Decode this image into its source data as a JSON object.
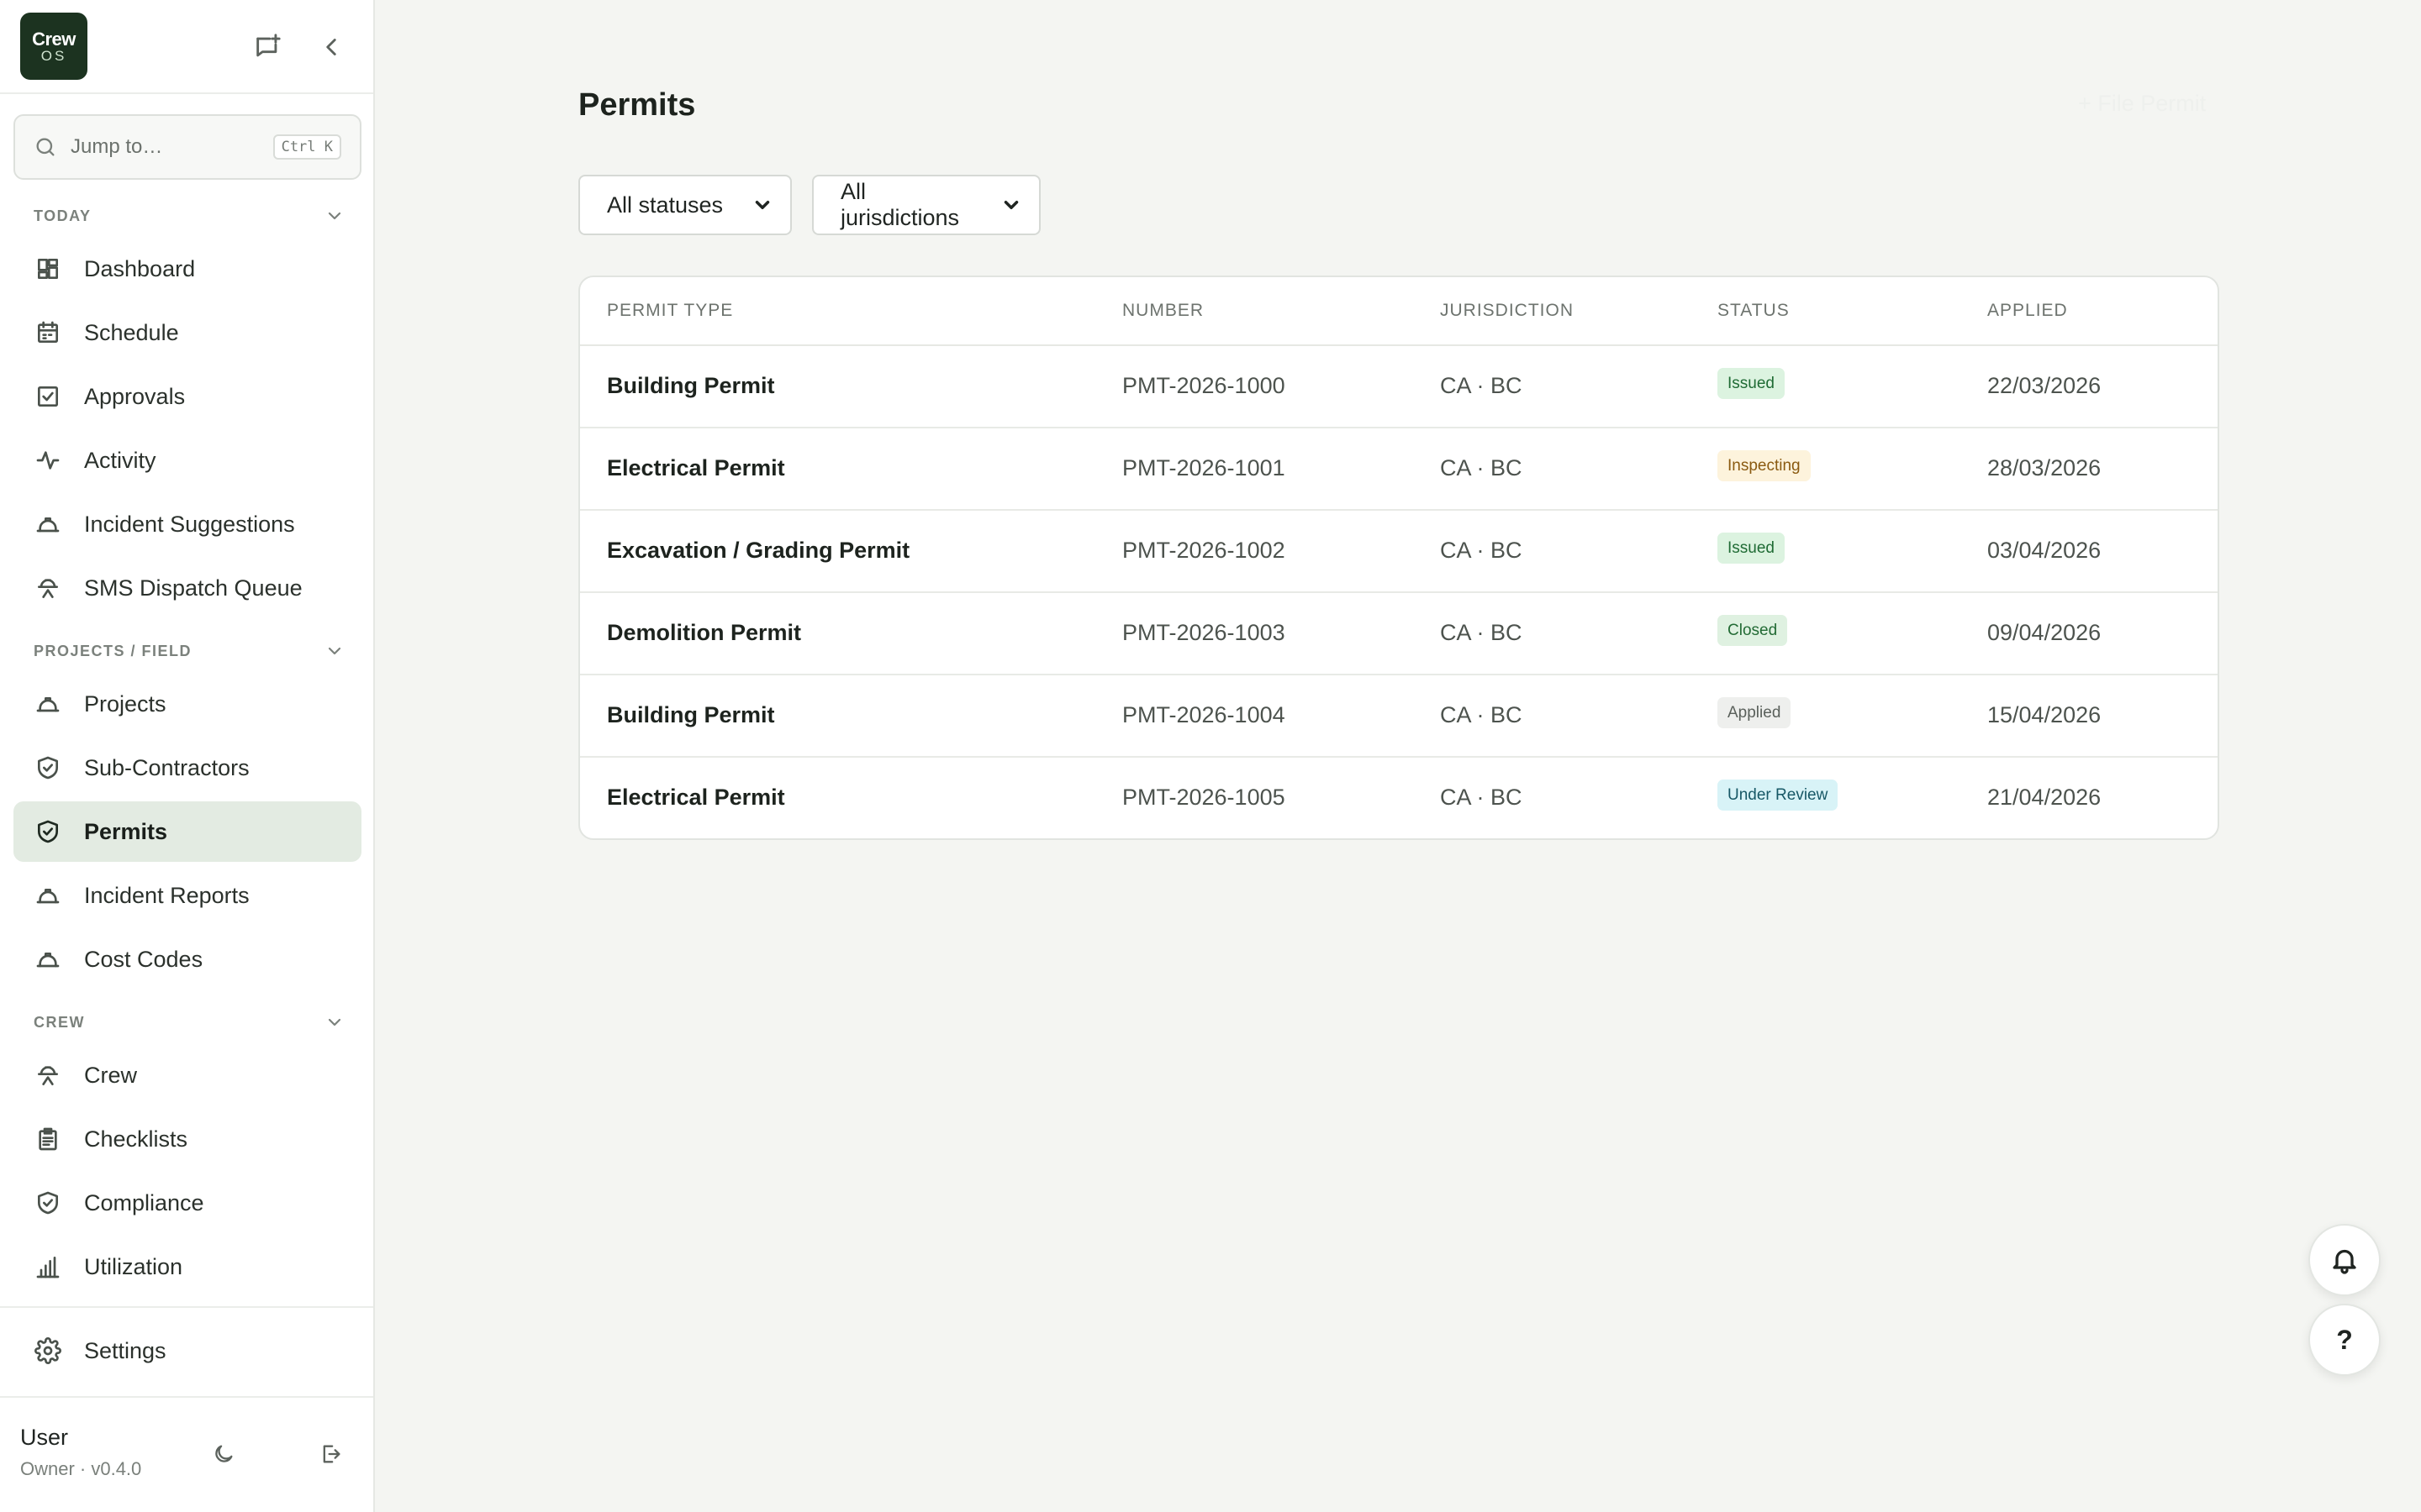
{
  "brand": {
    "line1": "Crew",
    "line2": "OS"
  },
  "search": {
    "placeholder": "Jump to…",
    "shortcut": "Ctrl K"
  },
  "sidebar": {
    "sections": [
      {
        "title": "TODAY",
        "items": [
          {
            "label": "Dashboard",
            "icon": "dashboard-icon"
          },
          {
            "label": "Schedule",
            "icon": "calendar-icon"
          },
          {
            "label": "Approvals",
            "icon": "checkbox-icon"
          },
          {
            "label": "Activity",
            "icon": "activity-icon"
          },
          {
            "label": "Incident Suggestions",
            "icon": "hardhat-icon"
          },
          {
            "label": "SMS Dispatch Queue",
            "icon": "worker-icon"
          }
        ]
      },
      {
        "title": "PROJECTS / FIELD",
        "items": [
          {
            "label": "Projects",
            "icon": "hardhat-icon"
          },
          {
            "label": "Sub-Contractors",
            "icon": "shield-check-icon"
          },
          {
            "label": "Permits",
            "icon": "shield-check-icon",
            "active": true
          },
          {
            "label": "Incident Reports",
            "icon": "hardhat-icon"
          },
          {
            "label": "Cost Codes",
            "icon": "hardhat-icon"
          }
        ]
      },
      {
        "title": "CREW",
        "items": [
          {
            "label": "Crew",
            "icon": "worker-icon"
          },
          {
            "label": "Checklists",
            "icon": "clipboard-icon"
          },
          {
            "label": "Compliance",
            "icon": "shield-check-icon"
          },
          {
            "label": "Utilization",
            "icon": "bar-chart-icon"
          }
        ]
      }
    ],
    "settings": {
      "label": "Settings",
      "icon": "gear-icon"
    }
  },
  "user": {
    "name": "User",
    "meta": "Owner · v0.4.0"
  },
  "page": {
    "title": "Permits",
    "file_button": "+ File Permit",
    "filters": {
      "status": "All statuses",
      "jurisdiction": "All jurisdictions"
    }
  },
  "table": {
    "columns": [
      "PERMIT TYPE",
      "NUMBER",
      "JURISDICTION",
      "STATUS",
      "APPLIED"
    ],
    "rows": [
      {
        "type": "Building Permit",
        "number": "PMT-2026-1000",
        "jurisdiction": "CA · BC",
        "status": "Issued",
        "applied": "22/03/2026"
      },
      {
        "type": "Electrical Permit",
        "number": "PMT-2026-1001",
        "jurisdiction": "CA · BC",
        "status": "Inspecting",
        "applied": "28/03/2026"
      },
      {
        "type": "Excavation / Grading Permit",
        "number": "PMT-2026-1002",
        "jurisdiction": "CA · BC",
        "status": "Issued",
        "applied": "03/04/2026"
      },
      {
        "type": "Demolition Permit",
        "number": "PMT-2026-1003",
        "jurisdiction": "CA · BC",
        "status": "Closed",
        "applied": "09/04/2026"
      },
      {
        "type": "Building Permit",
        "number": "PMT-2026-1004",
        "jurisdiction": "CA · BC",
        "status": "Applied",
        "applied": "15/04/2026"
      },
      {
        "type": "Electrical Permit",
        "number": "PMT-2026-1005",
        "jurisdiction": "CA · BC",
        "status": "Under Review",
        "applied": "21/04/2026"
      }
    ]
  },
  "status_colors": {
    "Issued": {
      "bg": "#dcf3e0",
      "fg": "#1f6b34"
    },
    "Inspecting": {
      "bg": "#fdf3dc",
      "fg": "#8a5a10"
    },
    "Closed": {
      "bg": "#dff1e1",
      "fg": "#236b35"
    },
    "Applied": {
      "bg": "#eeefed",
      "fg": "#5a605b"
    },
    "Under Review": {
      "bg": "#d8f3f7",
      "fg": "#175866"
    }
  },
  "colors": {
    "accent": "#1c3320",
    "active_nav_bg": "#e3ebe2",
    "page_bg": "#f4f5f2"
  }
}
